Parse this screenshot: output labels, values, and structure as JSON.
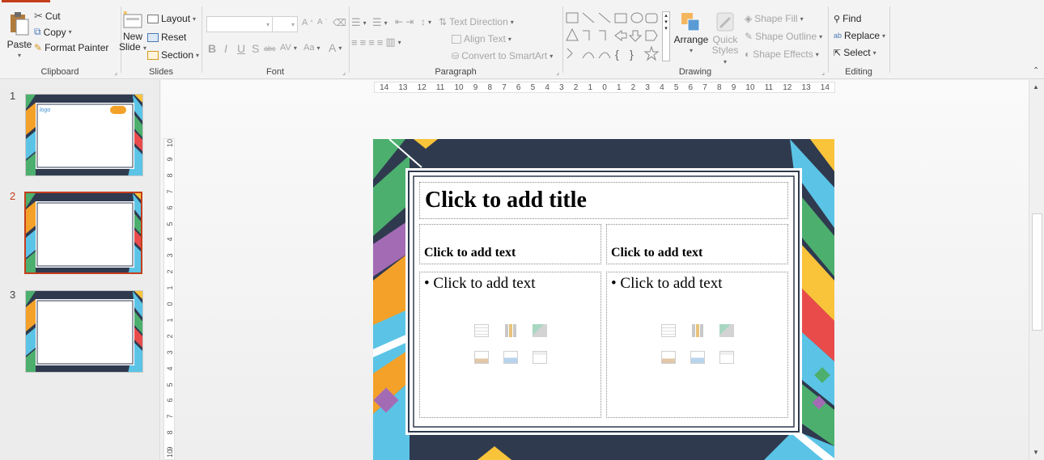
{
  "ribbon": {
    "clipboard": {
      "paste": "Paste",
      "cut": "Cut",
      "copy": "Copy",
      "format_painter": "Format Painter",
      "group": "Clipboard"
    },
    "slides": {
      "new_slide_1": "New",
      "new_slide_2": "Slide",
      "layout": "Layout",
      "reset": "Reset",
      "section": "Section",
      "group": "Slides"
    },
    "font": {
      "bold": "B",
      "italic": "I",
      "underline": "U",
      "shadow": "S",
      "strike": "abc",
      "spacing": "AV",
      "case": "Aa",
      "color": "A",
      "grow": "A",
      "shrink": "A",
      "group": "Font"
    },
    "paragraph": {
      "text_direction": "Text Direction",
      "align_text": "Align Text",
      "smartart": "Convert to SmartArt",
      "group": "Paragraph"
    },
    "drawing": {
      "arrange": "Arrange",
      "quick_styles_1": "Quick",
      "quick_styles_2": "Styles",
      "shape_fill": "Shape Fill",
      "shape_outline": "Shape Outline",
      "shape_effects": "Shape Effects",
      "group": "Drawing"
    },
    "editing": {
      "find": "Find",
      "replace": "Replace",
      "select": "Select",
      "group": "Editing"
    }
  },
  "thumbnails": [
    {
      "number": "1",
      "logo_text": "logo",
      "active": false
    },
    {
      "number": "2",
      "active": true
    },
    {
      "number": "3",
      "active": false
    }
  ],
  "ruler": {
    "horizontal": [
      "14",
      "13",
      "12",
      "11",
      "10",
      "9",
      "8",
      "7",
      "6",
      "5",
      "4",
      "3",
      "2",
      "1",
      "0",
      "1",
      "2",
      "3",
      "4",
      "5",
      "6",
      "7",
      "8",
      "9",
      "10",
      "11",
      "12",
      "13",
      "14"
    ],
    "vertical": [
      "10",
      "9",
      "8",
      "7",
      "6",
      "5",
      "4",
      "3",
      "2",
      "1",
      "0",
      "1",
      "2",
      "3",
      "4",
      "5",
      "6",
      "7",
      "8",
      "9",
      "10"
    ]
  },
  "slide": {
    "title": "Click to add title",
    "left_heading": "Click to add text",
    "right_heading": "Click to add text",
    "left_body": "• Click to add text",
    "right_body": "• Click to add text"
  },
  "colors": {
    "accent": "#c43e1c",
    "navy": "#2f3a4f",
    "green": "#4caf6e",
    "yellow": "#f9c33a",
    "orange": "#f4a12a",
    "cyan": "#5bc4e6",
    "red": "#e94b4b",
    "purple": "#a46bb5"
  }
}
